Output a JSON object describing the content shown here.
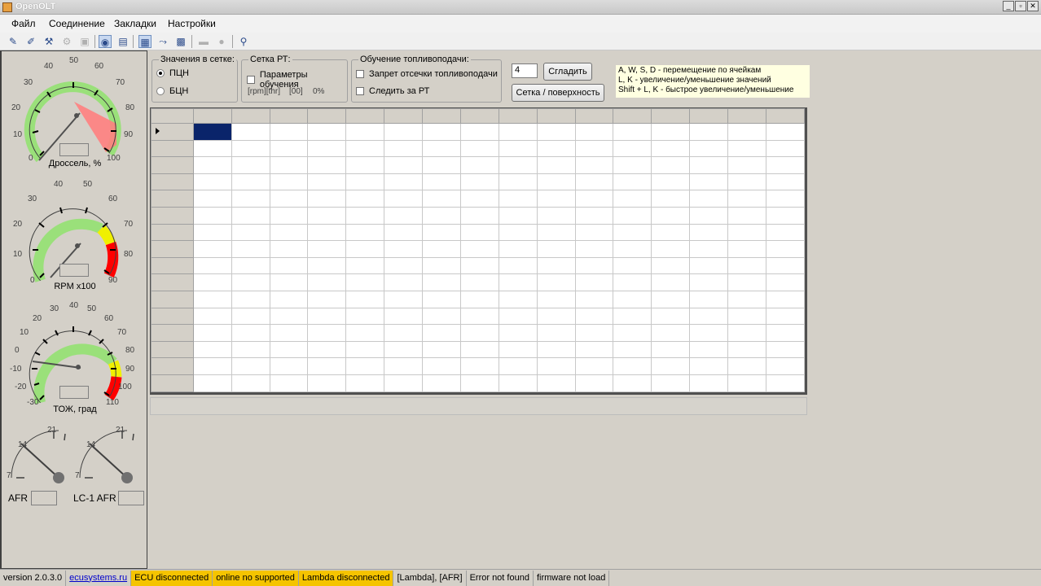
{
  "window": {
    "title": "OpenOLT",
    "buttons": [
      "_",
      "▫",
      "✕"
    ]
  },
  "menu": [
    "Файл",
    "Соединение",
    "Закладки",
    "Настройки"
  ],
  "colors": {
    "gauge_green": "#9ae07a",
    "gauge_yellow": "#f0f000",
    "gauge_red": "#ff0000",
    "gauge_pink": "#ff8080",
    "status_yellow": "#f5c400",
    "selected_cell": "#0a246a",
    "hint_bg": "#ffffe1"
  },
  "gauges": {
    "throttle": {
      "label": "Дроссель, %",
      "ticks": [
        "0",
        "10",
        "20",
        "30",
        "40",
        "50",
        "60",
        "70",
        "80",
        "90",
        "100"
      ],
      "value": 0
    },
    "rpm": {
      "label": "RPM x100",
      "ticks": [
        "0",
        "10",
        "20",
        "30",
        "40",
        "50",
        "60",
        "70",
        "80",
        "90"
      ],
      "value": 0
    },
    "temp": {
      "label": "ТОЖ, град",
      "ticks": [
        "-30",
        "-20",
        "-10",
        "0",
        "10",
        "20",
        "30",
        "40",
        "50",
        "60",
        "70",
        "80",
        "90",
        "100",
        "110"
      ],
      "value": -12
    },
    "afr": {
      "label": "AFR",
      "ticks": [
        "7",
        "14",
        "21"
      ]
    },
    "lc1": {
      "label": "LC-1 AFR",
      "ticks": [
        "7",
        "14",
        "21"
      ]
    }
  },
  "grid_values": {
    "title": "Значения в сетке:",
    "options": [
      "ПЦН",
      "БЦН"
    ],
    "selected": "ПЦН"
  },
  "rt_grid": {
    "title": "Сетка РТ:",
    "checkbox": "Параметры обучения",
    "info1": "[rpm][thr]",
    "info2": "[00]",
    "info3": "0%"
  },
  "fuel_learning": {
    "title": "Обучение топливоподачи:",
    "checkboxes": [
      "Запрет отсечки топливоподачи",
      "Следить за РТ"
    ]
  },
  "smooth_value": "4",
  "buttons": {
    "smooth": "Сгладить",
    "grid_surface": "Сетка / поверхность"
  },
  "hints": [
    "A, W, S, D - перемещение по ячейкам",
    "L, K - увеличение/уменьшение значений",
    "Shift + L, K - быстрое увеличение/уменьшение"
  ],
  "status": {
    "version": "version 2.0.3.0",
    "link": "ecusystems.ru",
    "ecu": "ECU disconnected",
    "online": "online no supported",
    "lambda": "Lambda disconnected",
    "lambda_afr": "[Lambda], [AFR]",
    "error": "Error not found",
    "firmware": "firmware not load"
  }
}
